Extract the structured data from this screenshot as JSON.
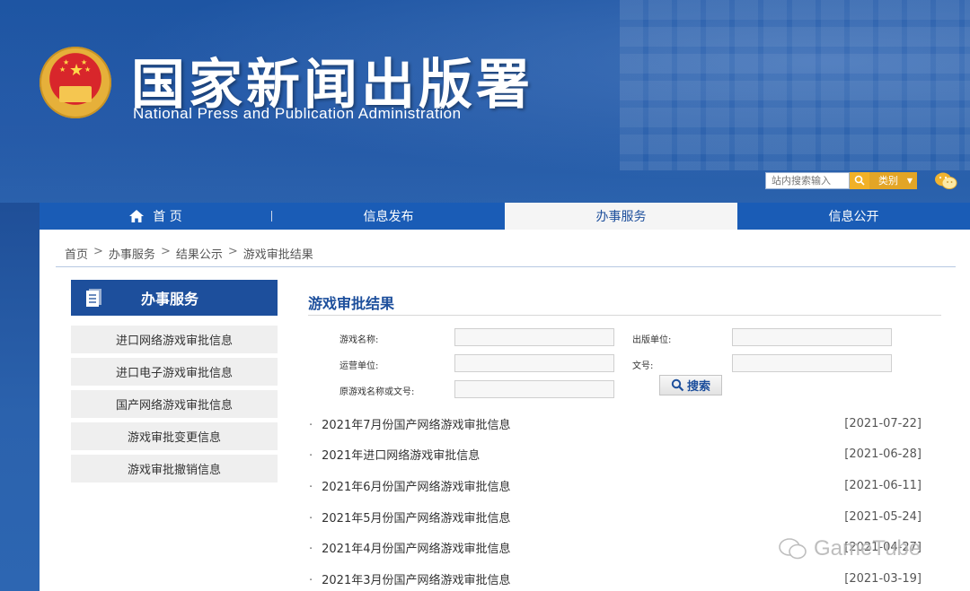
{
  "header": {
    "title": "国家新闻出版署",
    "subtitle": "National  Press and Publication Administration",
    "search_placeholder": "站内搜索输入",
    "category_label": "类别"
  },
  "nav": {
    "items": [
      {
        "label": "首 页",
        "icon": "home-icon"
      },
      {
        "label": "信息发布"
      },
      {
        "label": "办事服务",
        "active": true
      },
      {
        "label": "信息公开"
      }
    ]
  },
  "breadcrumb": [
    "首页",
    "办事服务",
    "结果公示",
    "游戏审批结果"
  ],
  "sidebar": {
    "title": "办事服务",
    "items": [
      "进口网络游戏审批信息",
      "进口电子游戏审批信息",
      "国产网络游戏审批信息",
      "游戏审批变更信息",
      "游戏审批撤销信息"
    ]
  },
  "main": {
    "title": "游戏审批结果",
    "form": {
      "game_name_label": "游戏名称:",
      "publisher_label": "出版单位:",
      "operator_label": "运营单位:",
      "doc_no_label": "文号:",
      "original_label": "原游戏名称或文号:",
      "search_button": "搜索"
    },
    "list": [
      {
        "title": "2021年7月份国产网络游戏审批信息",
        "date": "[2021-07-22]"
      },
      {
        "title": "2021年进口网络游戏审批信息",
        "date": "[2021-06-28]"
      },
      {
        "title": "2021年6月份国产网络游戏审批信息",
        "date": "[2021-06-11]"
      },
      {
        "title": "2021年5月份国产网络游戏审批信息",
        "date": "[2021-05-24]"
      },
      {
        "title": "2021年4月份国产网络游戏审批信息",
        "date": "[2021-04-27]"
      },
      {
        "title": "2021年3月份国产网络游戏审批信息",
        "date": "[2021-03-19]"
      }
    ]
  },
  "watermark": {
    "text": "GameTube"
  },
  "colors": {
    "brand_blue": "#1d4f9c",
    "nav_blue": "#1a5cb6",
    "accent_orange": "#e3a526"
  }
}
